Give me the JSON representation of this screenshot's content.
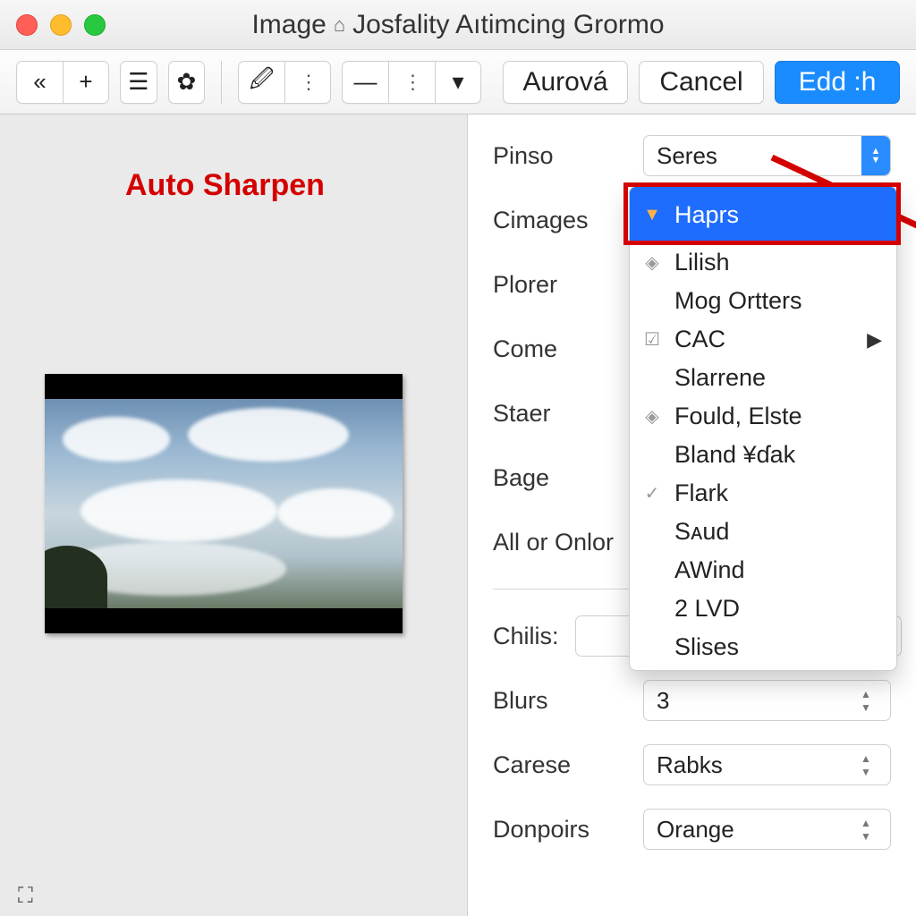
{
  "titlebar": {
    "prefix": "Image",
    "title": "Josfality Aıtimcing Grormo"
  },
  "toolbar": {
    "aurora": "Aurová",
    "cancel": "Cancel",
    "apply": "Edd :h"
  },
  "annotation": {
    "label": "Auto Sharpen"
  },
  "panel": {
    "pinso_label": "Pinso",
    "pinso_value": "Seres",
    "cimages_label": "Cimages",
    "plorer_label": "Plorer",
    "come_label": "Come",
    "staer_label": "Staer",
    "bage_label": "Bage",
    "all_label": "All or Onlor",
    "chilis_label": "Chilis:",
    "chilis_value": "",
    "blurs_label": "Blurs",
    "blurs_value": "3",
    "carese_label": "Carese",
    "carese_value": "Rabks",
    "donpoirs_label": "Donpoirs",
    "donpoirs_value": "Orange"
  },
  "dropdown": {
    "items": [
      {
        "label": "Haprs",
        "selected": true,
        "icon": "▼"
      },
      {
        "label": "Lilish",
        "icon": "◈"
      },
      {
        "label": "Mog Ortters",
        "icon": ""
      },
      {
        "label": "CAC",
        "icon": "☑",
        "submenu": true
      },
      {
        "label": "Slarrene",
        "icon": ""
      },
      {
        "label": "Fould, Elste",
        "icon": "◈"
      },
      {
        "label": "Bland ¥ɗak",
        "icon": ""
      },
      {
        "label": "Flark",
        "icon": "✓"
      },
      {
        "label": "Sᴀud",
        "icon": ""
      },
      {
        "label": "AWind",
        "icon": ""
      },
      {
        "label": "2 LVD",
        "icon": ""
      },
      {
        "label": "Slises",
        "icon": ""
      }
    ]
  }
}
